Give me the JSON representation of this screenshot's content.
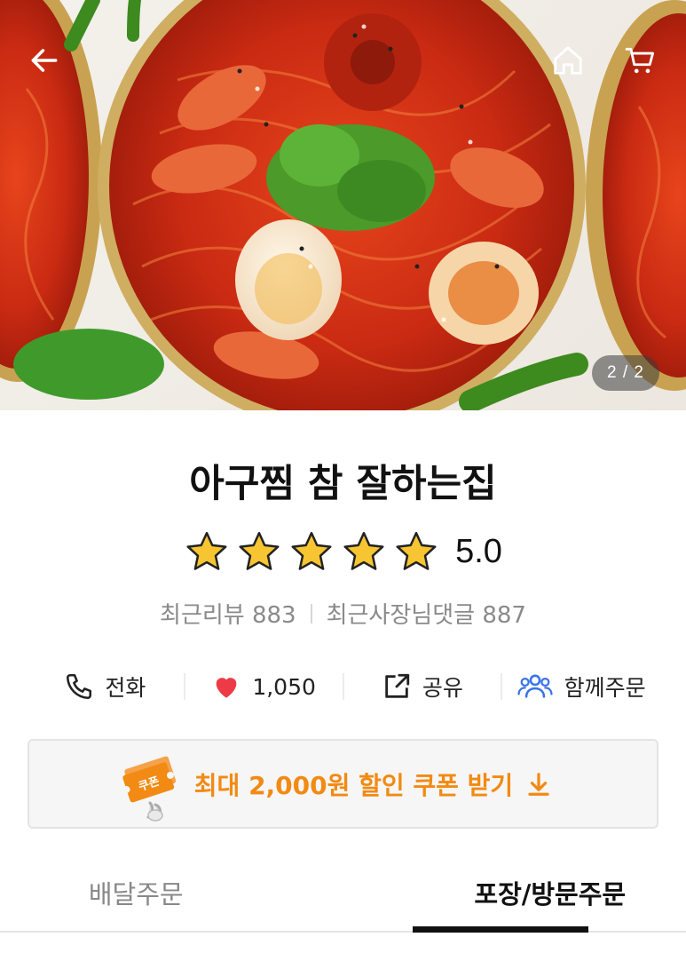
{
  "hero": {
    "page_indicator": "2 / 2",
    "icons": {
      "back": "arrow-left-icon",
      "home": "home-icon",
      "cart": "cart-icon"
    }
  },
  "store": {
    "name": "아구찜 참 잘하는집",
    "rating": "5.0",
    "star_count": 5,
    "recent_reviews": "최근리뷰 883",
    "owner_replies": "최근사장님댓글 887"
  },
  "actions": [
    {
      "icon": "phone-icon",
      "label": "전화"
    },
    {
      "icon": "heart-icon",
      "label": "1,050"
    },
    {
      "icon": "share-icon",
      "label": "공유"
    },
    {
      "icon": "group-order-icon",
      "label": "함께주문"
    }
  ],
  "coupon": {
    "label": "최대 2,000원 할인 쿠폰 받기",
    "badge_text": "쿠폰",
    "accent_color": "#f28a13"
  },
  "tabs": [
    {
      "label": "배달주문",
      "active": false
    },
    {
      "label": "포장/방문주문",
      "active": true
    }
  ],
  "colors": {
    "star": "#f7c531",
    "heart": "#ec3b46",
    "group_icon": "#3a73e8",
    "text_primary": "#111111",
    "text_secondary": "#8a8a8a"
  }
}
